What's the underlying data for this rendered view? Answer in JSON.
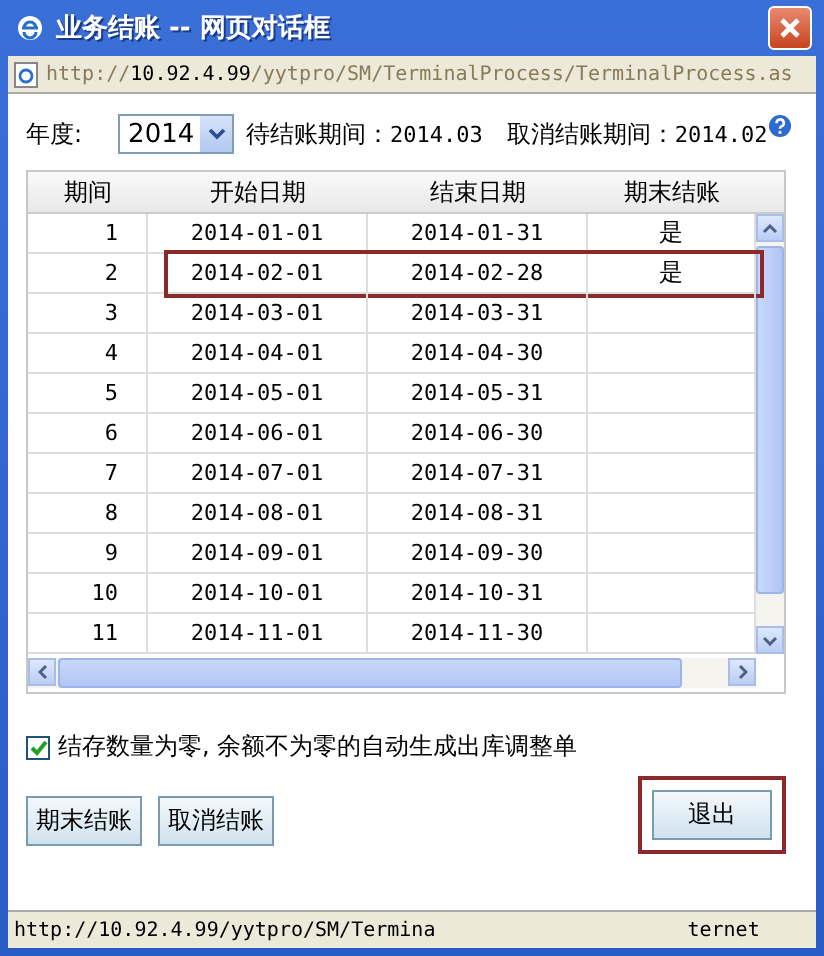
{
  "window": {
    "title": "业务结账 -- 网页对话框"
  },
  "address_bar": {
    "url_prefix": "http://",
    "host": "10.92.4.99",
    "path": "/yytpro/SM/TerminalProcess/TerminalProcess.as"
  },
  "filter": {
    "year_label": "年度:",
    "year": "2014",
    "pending_label": "待结账期间：",
    "pending_value": "2014.03",
    "cancel_label": "取消结账期间：",
    "cancel_value": "2014.02"
  },
  "table": {
    "columns": [
      "期间",
      "开始日期",
      "结束日期",
      "期末结账"
    ],
    "rows": [
      {
        "cells": [
          "1",
          "2014-01-01",
          "2014-01-31",
          "是"
        ],
        "highlighted": false
      },
      {
        "cells": [
          "2",
          "2014-02-01",
          "2014-02-28",
          "是"
        ],
        "highlighted": true
      },
      {
        "cells": [
          "3",
          "2014-03-01",
          "2014-03-31",
          ""
        ],
        "highlighted": false
      },
      {
        "cells": [
          "4",
          "2014-04-01",
          "2014-04-30",
          ""
        ],
        "highlighted": false
      },
      {
        "cells": [
          "5",
          "2014-05-01",
          "2014-05-31",
          ""
        ],
        "highlighted": false
      },
      {
        "cells": [
          "6",
          "2014-06-01",
          "2014-06-30",
          ""
        ],
        "highlighted": false
      },
      {
        "cells": [
          "7",
          "2014-07-01",
          "2014-07-31",
          ""
        ],
        "highlighted": false
      },
      {
        "cells": [
          "8",
          "2014-08-01",
          "2014-08-31",
          ""
        ],
        "highlighted": false
      },
      {
        "cells": [
          "9",
          "2014-09-01",
          "2014-09-30",
          ""
        ],
        "highlighted": false
      },
      {
        "cells": [
          "10",
          "2014-10-01",
          "2014-10-31",
          ""
        ],
        "highlighted": false
      },
      {
        "cells": [
          "11",
          "2014-11-01",
          "2014-11-30",
          ""
        ],
        "highlighted": false
      }
    ]
  },
  "option": {
    "label": "结存数量为零, 余额不为零的自动生成出库调整单",
    "checked": true
  },
  "buttons": [
    {
      "label": "期末结账",
      "highlighted": false
    },
    {
      "label": "取消结账",
      "highlighted": false
    },
    {
      "label": "退出",
      "highlighted": true
    }
  ],
  "status_bar": {
    "url": "http://10.92.4.99/yytpro/SM/Termina",
    "zone": "ternet"
  }
}
